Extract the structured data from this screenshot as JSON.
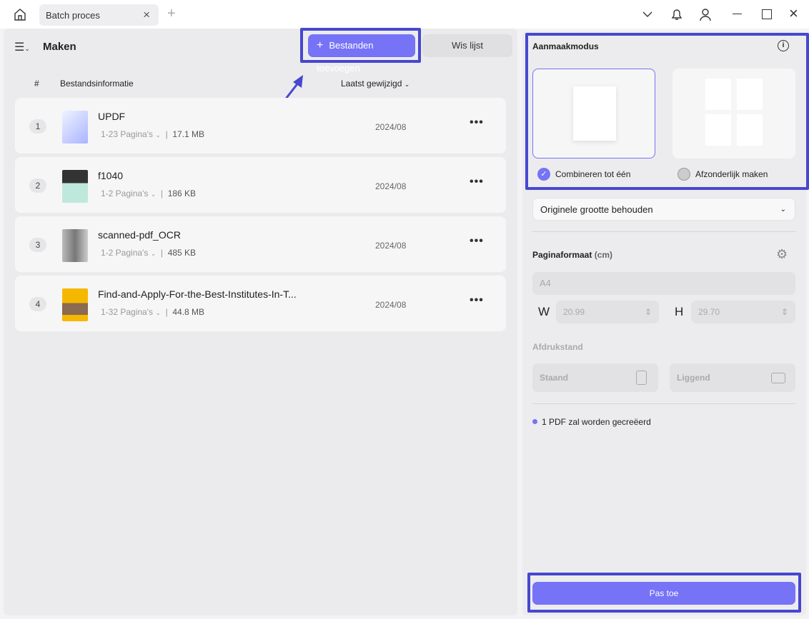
{
  "tab": {
    "title": "Batch proces"
  },
  "header": {
    "title": "Maken",
    "add_label": "Bestanden toevoegen",
    "clear_label": "Wis lijst"
  },
  "columns": {
    "num": "#",
    "info": "Bestandsinformatie",
    "modified": "Laatst gewijzigd"
  },
  "files": [
    {
      "num": "1",
      "name": "UPDF",
      "pages": "1-23 Pagina's",
      "size": "17.1 MB",
      "date": "2024/08"
    },
    {
      "num": "2",
      "name": "f1040",
      "pages": "1-2 Pagina's",
      "size": "186 KB",
      "date": "2024/08"
    },
    {
      "num": "3",
      "name": "scanned-pdf_OCR",
      "pages": "1-2 Pagina's",
      "size": "485 KB",
      "date": "2024/08"
    },
    {
      "num": "4",
      "name": "Find-and-Apply-For-the-Best-Institutes-In-T...",
      "pages": "1-32 Pagina's",
      "size": "44.8 MB",
      "date": "2024/08"
    }
  ],
  "panel": {
    "mode_title": "Aanmaakmodus",
    "combine_label": "Combineren tot één",
    "separate_label": "Afzonderlijk maken",
    "size_select": "Originele grootte behouden",
    "page_format_title": "Paginaformaat",
    "page_format_unit": "(cm)",
    "paper": "A4",
    "w_label": "W",
    "w_value": "20.99",
    "h_label": "H",
    "h_value": "29.70",
    "orientation_title": "Afdrukstand",
    "portrait": "Staand",
    "landscape": "Liggend",
    "status": "1 PDF zal worden gecreëerd",
    "apply": "Pas toe"
  },
  "colors": {
    "accent": "#7673f6",
    "highlight": "#4747d0"
  }
}
